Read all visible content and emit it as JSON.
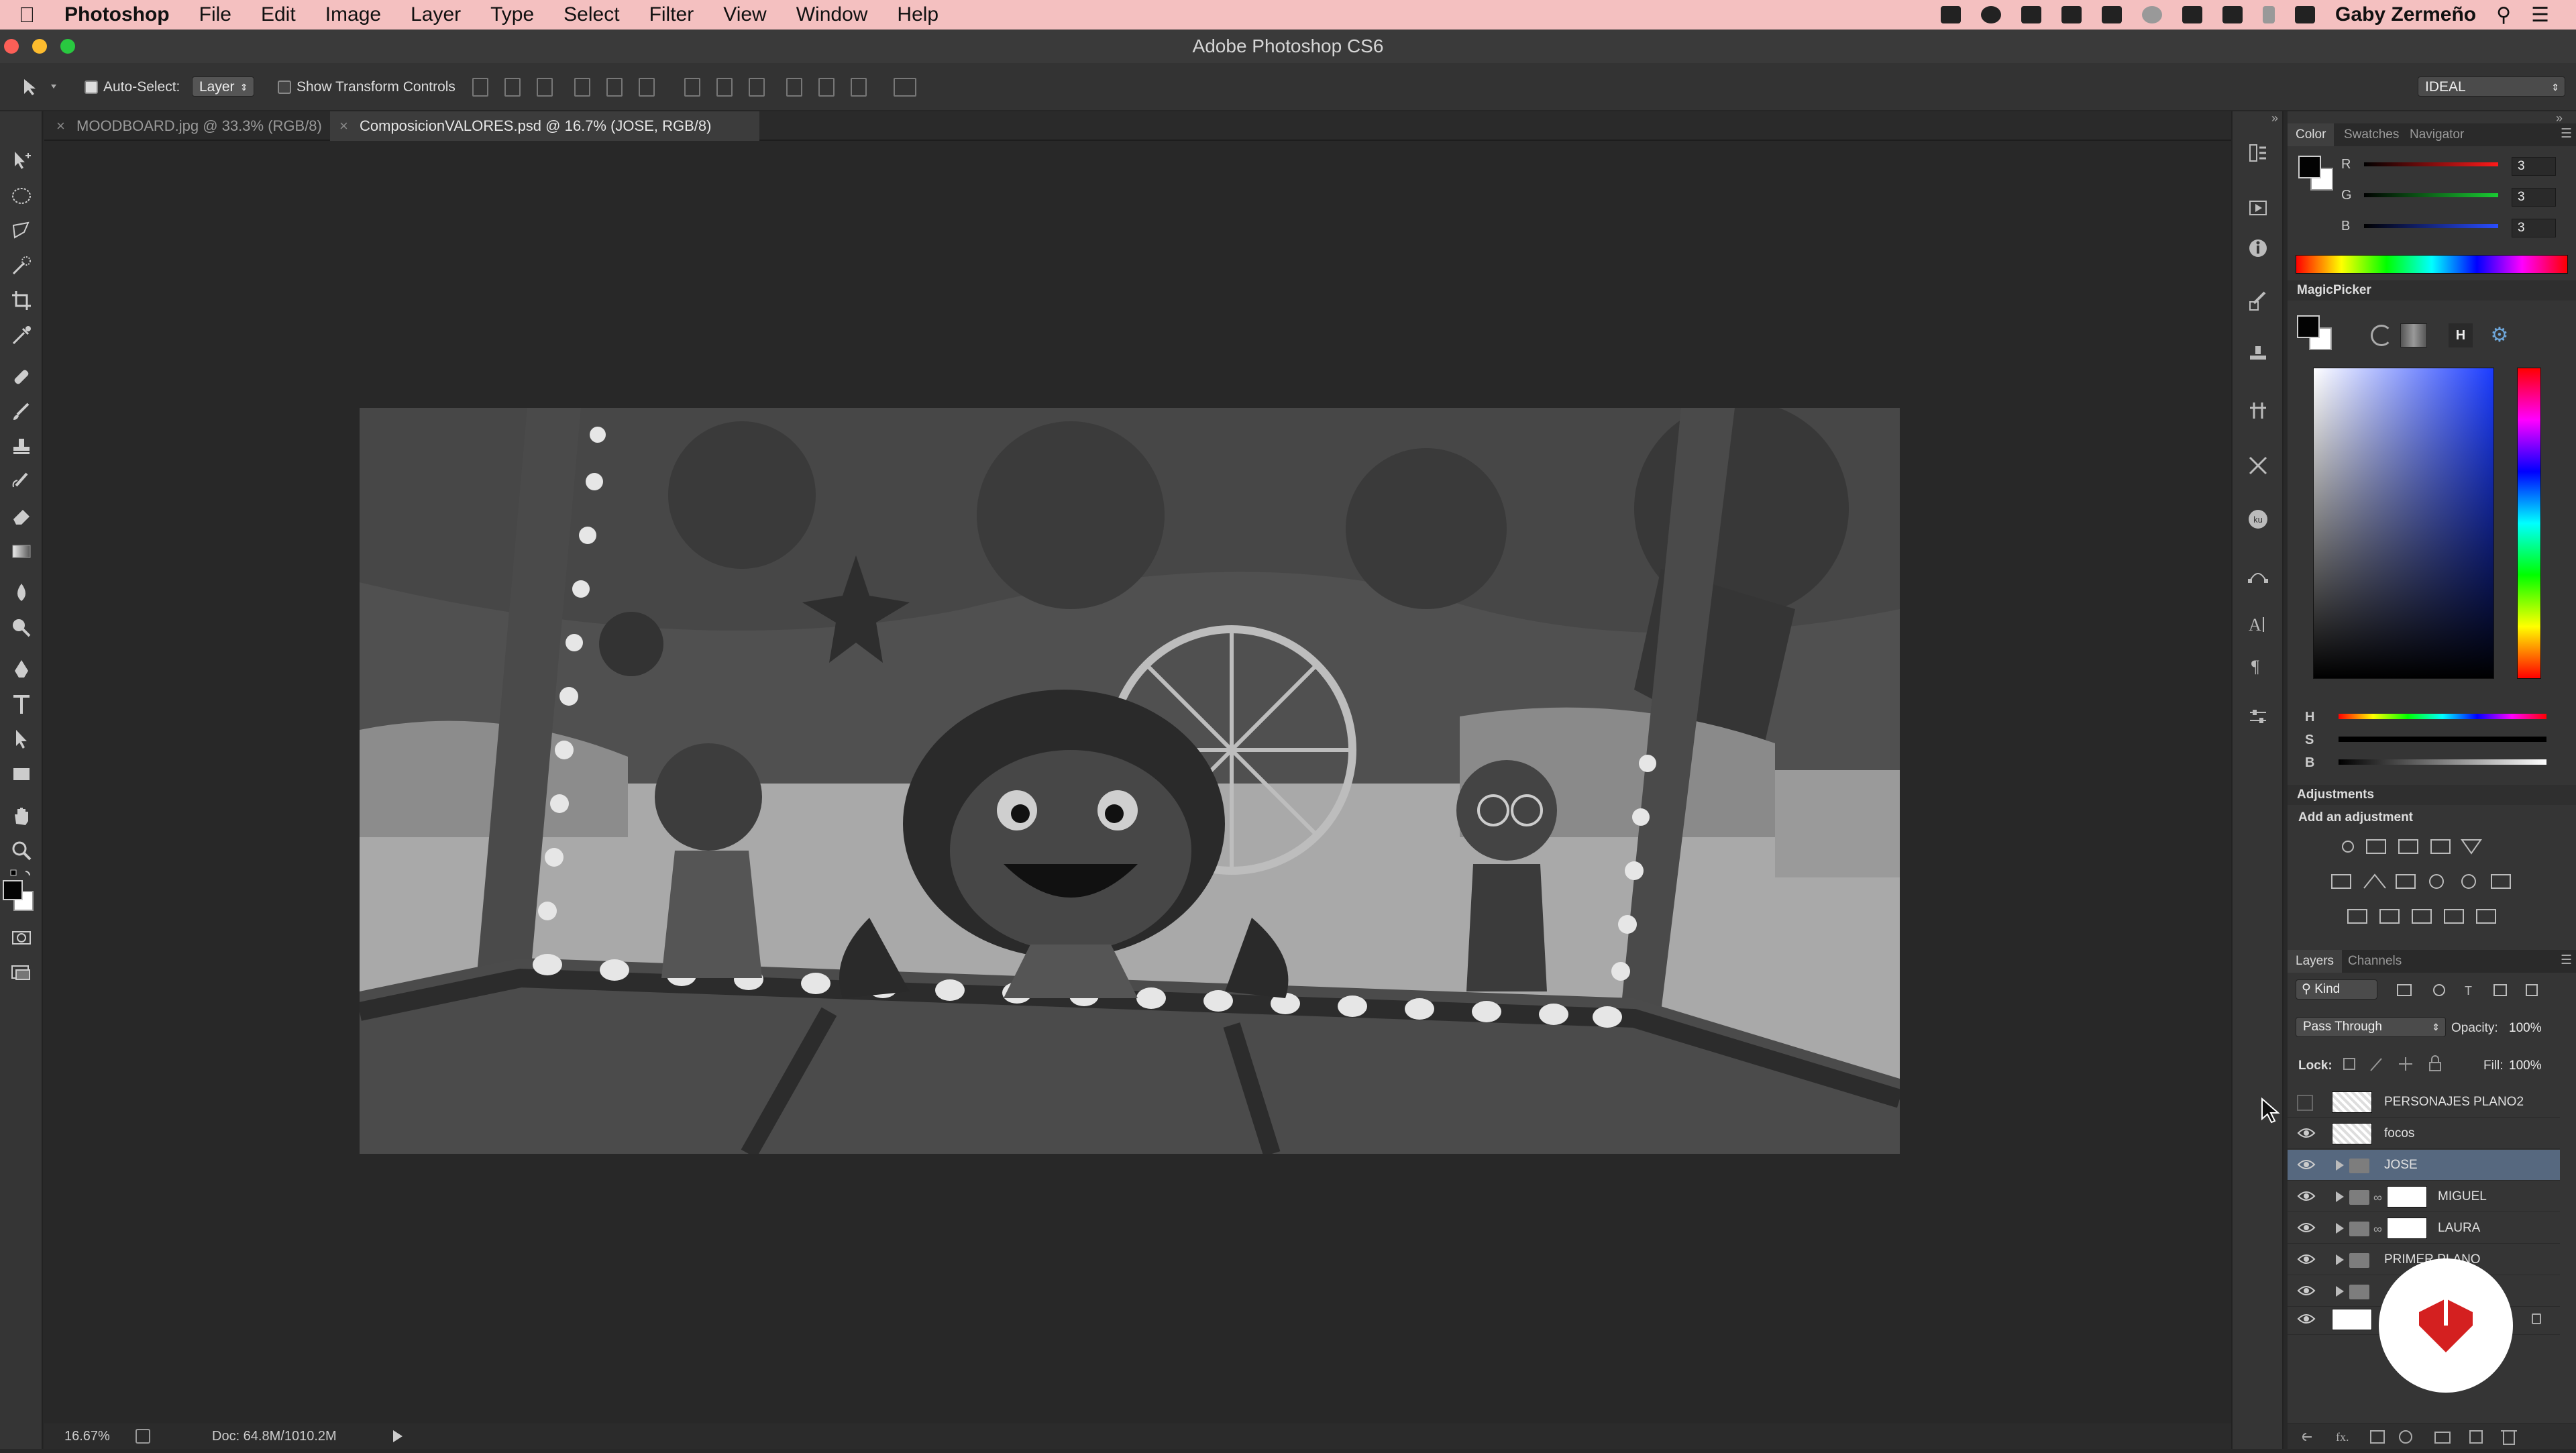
{
  "menubar": {
    "app": "Photoshop",
    "items": [
      "File",
      "Edit",
      "Image",
      "Layer",
      "Type",
      "Select",
      "Filter",
      "View",
      "Window",
      "Help"
    ],
    "user": "Gaby Zermeño"
  },
  "window": {
    "title": "Adobe Photoshop CS6"
  },
  "options": {
    "auto_select_label": "Auto-Select:",
    "auto_select_value": "Layer",
    "transform_label": "Show Transform Controls",
    "workspace": "IDEAL"
  },
  "tabs": [
    {
      "label": "MOODBOARD.jpg @ 33.3% (RGB/8)"
    },
    {
      "label": "ComposicionVALORES.psd @ 16.7% (JOSE, RGB/8)"
    }
  ],
  "status": {
    "zoom": "16.67%",
    "doc": "Doc: 64.8M/1010.2M"
  },
  "color_panel": {
    "tabs": [
      "Color",
      "Swatches",
      "Navigator"
    ],
    "r_label": "R",
    "g_label": "G",
    "b_label": "B",
    "r": "3",
    "g": "3",
    "b": "3"
  },
  "magicpicker": {
    "title": "MagicPicker",
    "h_btn": "H",
    "h_label": "H",
    "s_label": "S",
    "b_label": "B"
  },
  "adjustments": {
    "title": "Adjustments",
    "subtitle": "Add an adjustment"
  },
  "layers_panel": {
    "tabs": [
      "Layers",
      "Channels"
    ],
    "kind": "Kind",
    "blend": "Pass Through",
    "opacity_label": "Opacity:",
    "opacity": "100%",
    "lock_label": "Lock:",
    "fill_label": "Fill:",
    "fill": "100%",
    "layers": [
      {
        "name": "PERSONAJES PLANO2"
      },
      {
        "name": "focos"
      },
      {
        "name": "JOSE"
      },
      {
        "name": "MIGUEL"
      },
      {
        "name": "LAURA"
      },
      {
        "name": "PRIMER PLANO"
      },
      {
        "name": ""
      },
      {
        "name": ""
      }
    ]
  }
}
